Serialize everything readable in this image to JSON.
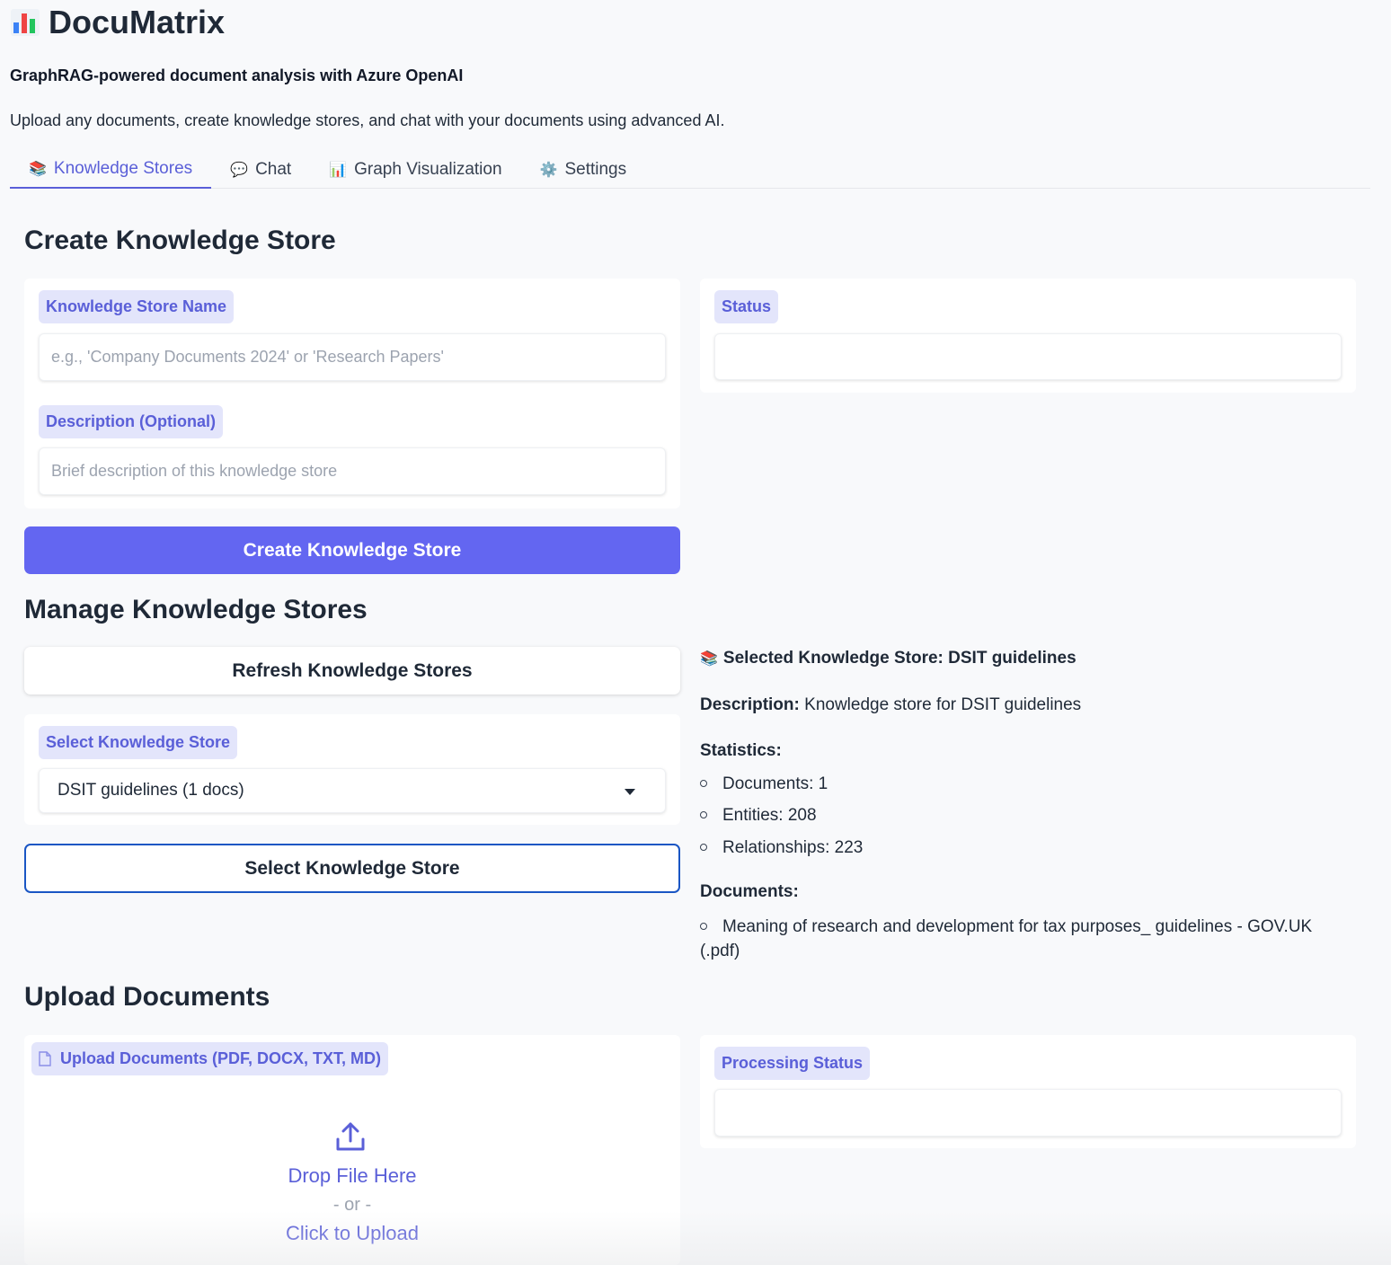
{
  "app": {
    "title": "DocuMatrix",
    "subtitle": "GraphRAG-powered document analysis with Azure OpenAI",
    "intro": "Upload any documents, create knowledge stores, and chat with your documents using advanced AI."
  },
  "tabs": [
    {
      "label": "Knowledge Stores",
      "icon": "books-icon",
      "active": true
    },
    {
      "label": "Chat",
      "icon": "speech-bubble-icon",
      "active": false
    },
    {
      "label": "Graph Visualization",
      "icon": "bar-chart-icon",
      "active": false
    },
    {
      "label": "Settings",
      "icon": "gear-icon",
      "active": false
    }
  ],
  "create": {
    "title": "Create Knowledge Store",
    "name_label": "Knowledge Store Name",
    "name_placeholder": "e.g., 'Company Documents 2024' or 'Research Papers'",
    "desc_label": "Description (Optional)",
    "desc_placeholder": "Brief description of this knowledge store",
    "status_label": "Status",
    "button": "Create Knowledge Store"
  },
  "manage": {
    "title": "Manage Knowledge Stores",
    "refresh_button": "Refresh Knowledge Stores",
    "select_label": "Select Knowledge Store",
    "selected_value": "DSIT guidelines (1 docs)",
    "select_button": "Select Knowledge Store"
  },
  "selected_info": {
    "heading": "Selected Knowledge Store: DSIT guidelines",
    "description_label": "Description:",
    "description": "Knowledge store for DSIT guidelines",
    "statistics_label": "Statistics:",
    "stats": [
      "Documents: 1",
      "Entities: 208",
      "Relationships: 223"
    ],
    "documents_label": "Documents:",
    "documents": [
      "Meaning of research and development for tax purposes_ guidelines - GOV.UK (.pdf)"
    ]
  },
  "upload": {
    "title": "Upload Documents",
    "label": "Upload Documents (PDF, DOCX, TXT, MD)",
    "drop": "Drop File Here",
    "or": "- or -",
    "click": "Click to Upload",
    "processing_label": "Processing Status"
  },
  "colors": {
    "accent": "#6366f1",
    "accent_text": "#5a5fd8",
    "chip_bg": "#e3e5fb",
    "outline": "#1a56c4"
  }
}
